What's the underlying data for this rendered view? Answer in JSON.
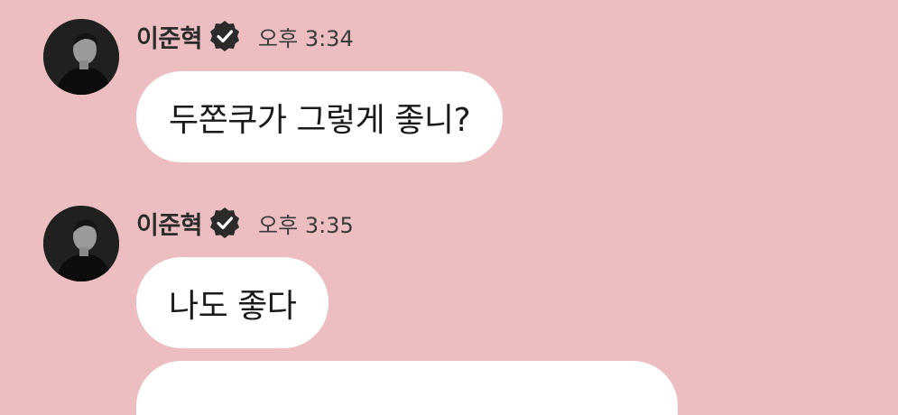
{
  "chat": {
    "messages": [
      {
        "sender": "이준혁",
        "time": "오후 3:34",
        "text": "두쫀쿠가 그렇게 좋니?"
      },
      {
        "sender": "이준혁",
        "time": "오후 3:35",
        "text": "나도 좋다"
      },
      {
        "text": ""
      }
    ]
  },
  "colors": {
    "background": "#ecbec2",
    "bubble": "#ffffff",
    "verified_badge": "#2b2b2b"
  },
  "icons": {
    "verified": "verified-badge-icon",
    "avatar": "profile-photo"
  }
}
